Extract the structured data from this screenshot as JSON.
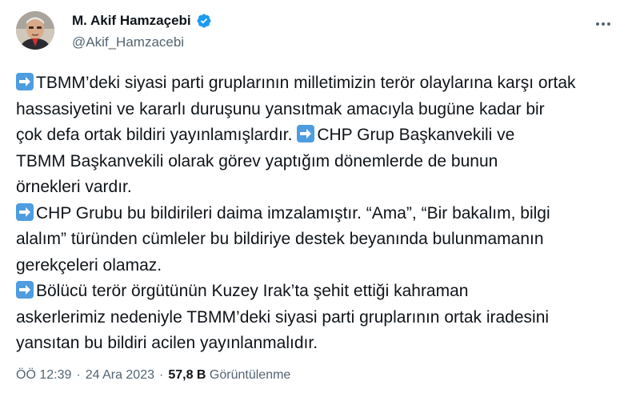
{
  "author": {
    "display_name": "M. Akif Hamzaçebi",
    "handle": "@Akif_Hamzacebi",
    "verified_icon": "verified-badge-icon",
    "verified_color": "#1d9bf0"
  },
  "tweet": {
    "lines": [
      {
        "arrow": true,
        "text": "TBMM’deki siyasi parti gruplarının milletimizin terör olaylarına karşı ortak"
      },
      {
        "arrow": false,
        "text": "hassasiyetini ve kararlı duruşunu yansıtmak amacıyla bugüne kadar bir"
      },
      {
        "arrow": false,
        "text": "çok defa ortak bildiri yayınlamışlardır. ",
        "arrow_after": true,
        "text_after": "CHP Grup Başkanvekili ve"
      },
      {
        "arrow": false,
        "text": "TBMM Başkanvekili olarak görev yaptığım dönemlerde de bunun"
      },
      {
        "arrow": false,
        "text": "örnekleri vardır."
      },
      {
        "arrow": true,
        "text": "CHP Grubu bu bildirileri daima imzalamıştır. “Ama”, “Bir bakalım, bilgi"
      },
      {
        "arrow": false,
        "text": "alalım” türünden cümleler  bu bildiriye destek beyanında bulunmamanın"
      },
      {
        "arrow": false,
        "text": "gerekçeleri olamaz."
      },
      {
        "arrow": true,
        "text": "Bölücü terör örgütünün Kuzey Irak’ta şehit ettiği kahraman"
      },
      {
        "arrow": false,
        "text": "askerlerimiz nedeniyle TBMM’deki siyasi parti gruplarının ortak iradesini"
      },
      {
        "arrow": false,
        "text": "yansıtan  bu bildiri acilen yayınlanmalıdır."
      }
    ],
    "emoji_icon": "right-arrow-emoji-icon",
    "emoji_color": "#4d9de0"
  },
  "meta": {
    "time": "ÖÖ 12:39",
    "separator": "·",
    "date": "24 Ara 2023",
    "views_count": "57,8 B",
    "views_label": "Görüntülenme"
  }
}
